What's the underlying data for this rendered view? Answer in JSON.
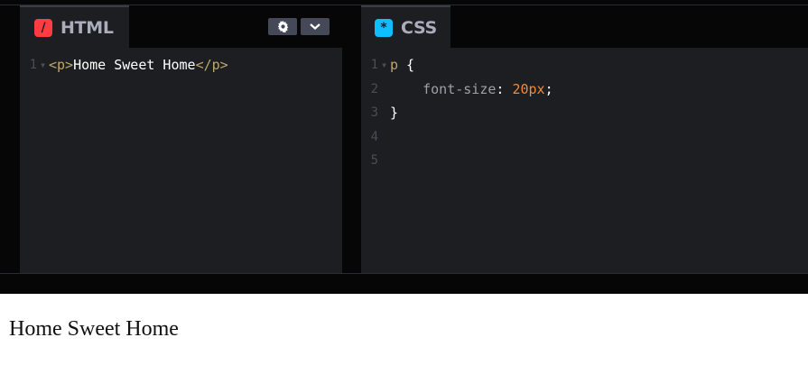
{
  "colors": {
    "html_accent": "#ff3c41",
    "css_accent": "#0ebeff",
    "editor_bg": "#1d1e22",
    "chrome_bg": "#060606",
    "tag_color": "#bfa76a",
    "number_color": "#ee8c3c"
  },
  "html_pane": {
    "tab_label": "HTML",
    "icon": "html-slash-icon",
    "buttons": [
      "gear-icon",
      "chevron-down-icon"
    ],
    "lines": [
      {
        "n": "1",
        "open_tag": "<p>",
        "text": "Home Sweet Home",
        "close_tag": "</p>"
      }
    ]
  },
  "css_pane": {
    "tab_label": "CSS",
    "icon": "css-asterisk-icon",
    "lines": [
      {
        "n": "1",
        "selector": "p",
        "brace": " {"
      },
      {
        "n": "2",
        "property": "font-size",
        "colon": ": ",
        "value": "20px",
        "semi": ";"
      },
      {
        "n": "3",
        "brace": "}"
      },
      {
        "n": "4"
      },
      {
        "n": "5"
      }
    ]
  },
  "preview": {
    "text": "Home Sweet Home"
  }
}
